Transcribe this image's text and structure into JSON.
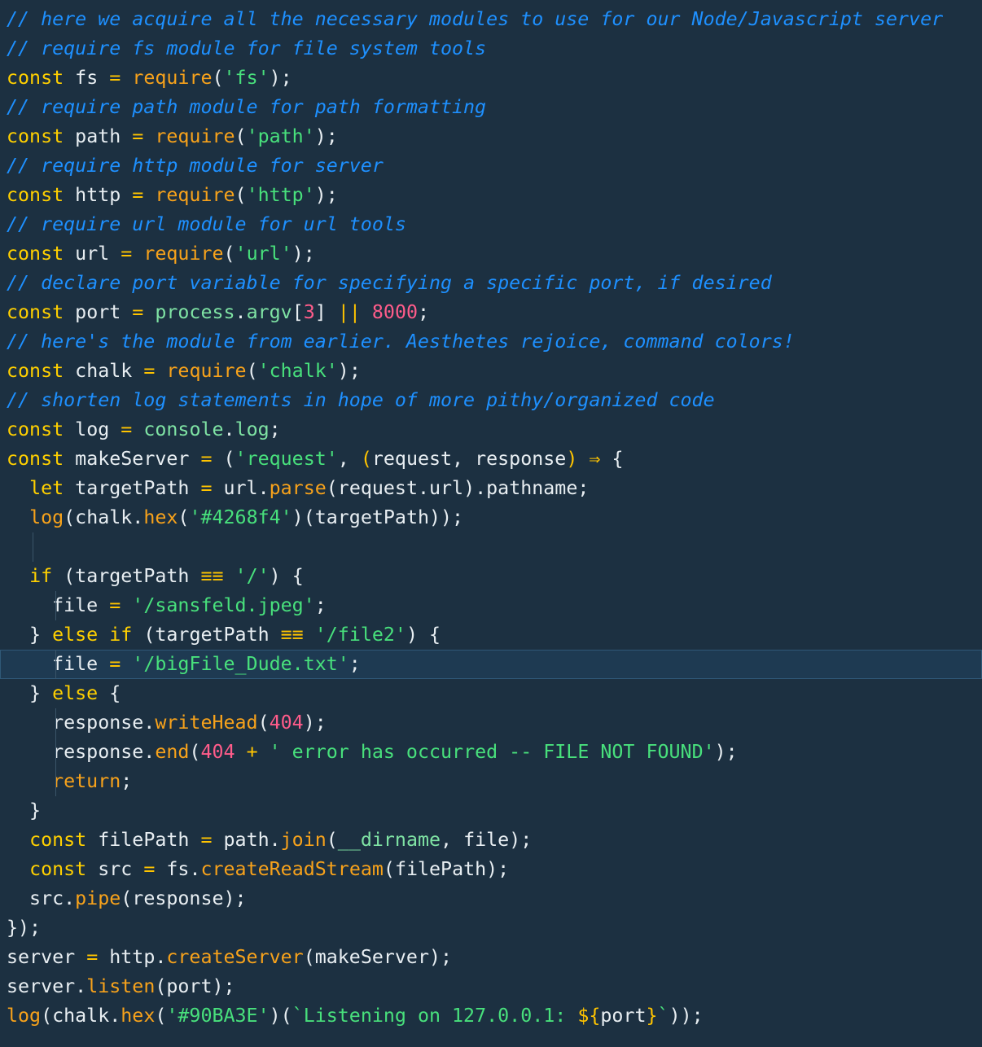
{
  "editor": {
    "colors": {
      "background": "#1c3041",
      "comment": "#1e90ff",
      "keyword": "#ffd000",
      "function": "#f7a21b",
      "string": "#48e07c",
      "number": "#ff5c8a",
      "operator": "#ffc400",
      "builtin": "#7fe3a4",
      "plain": "#e8eef2",
      "current_line": "#1e3a52"
    },
    "current_line_index": 22,
    "lines": [
      {
        "indent_guides": [],
        "tokens": [
          {
            "t": "comment",
            "v": "// here we acquire all the necessary modules to use for our Node/Javascript server"
          }
        ]
      },
      {
        "indent_guides": [],
        "tokens": [
          {
            "t": "comment",
            "v": "// require fs module for file system tools"
          }
        ]
      },
      {
        "indent_guides": [],
        "tokens": [
          {
            "t": "keyword",
            "v": "const"
          },
          {
            "t": "plain",
            "v": " fs "
          },
          {
            "t": "op",
            "v": "="
          },
          {
            "t": "plain",
            "v": " "
          },
          {
            "t": "func",
            "v": "require"
          },
          {
            "t": "punc",
            "v": "("
          },
          {
            "t": "string",
            "v": "'fs'"
          },
          {
            "t": "punc",
            "v": ");"
          }
        ]
      },
      {
        "indent_guides": [],
        "tokens": [
          {
            "t": "comment",
            "v": "// require path module for path formatting"
          }
        ]
      },
      {
        "indent_guides": [],
        "tokens": [
          {
            "t": "keyword",
            "v": "const"
          },
          {
            "t": "plain",
            "v": " path "
          },
          {
            "t": "op",
            "v": "="
          },
          {
            "t": "plain",
            "v": " "
          },
          {
            "t": "func",
            "v": "require"
          },
          {
            "t": "punc",
            "v": "("
          },
          {
            "t": "string",
            "v": "'path'"
          },
          {
            "t": "punc",
            "v": ");"
          }
        ]
      },
      {
        "indent_guides": [],
        "tokens": [
          {
            "t": "comment",
            "v": "// require http module for server"
          }
        ]
      },
      {
        "indent_guides": [],
        "tokens": [
          {
            "t": "keyword",
            "v": "const"
          },
          {
            "t": "plain",
            "v": " http "
          },
          {
            "t": "op",
            "v": "="
          },
          {
            "t": "plain",
            "v": " "
          },
          {
            "t": "func",
            "v": "require"
          },
          {
            "t": "punc",
            "v": "("
          },
          {
            "t": "string",
            "v": "'http'"
          },
          {
            "t": "punc",
            "v": ");"
          }
        ]
      },
      {
        "indent_guides": [],
        "tokens": [
          {
            "t": "comment",
            "v": "// require url module for url tools"
          }
        ]
      },
      {
        "indent_guides": [],
        "tokens": [
          {
            "t": "keyword",
            "v": "const"
          },
          {
            "t": "plain",
            "v": " url "
          },
          {
            "t": "op",
            "v": "="
          },
          {
            "t": "plain",
            "v": " "
          },
          {
            "t": "func",
            "v": "require"
          },
          {
            "t": "punc",
            "v": "("
          },
          {
            "t": "string",
            "v": "'url'"
          },
          {
            "t": "punc",
            "v": ");"
          }
        ]
      },
      {
        "indent_guides": [],
        "tokens": [
          {
            "t": "comment",
            "v": "// declare port variable for specifying a specific port, if desired"
          }
        ]
      },
      {
        "indent_guides": [],
        "tokens": [
          {
            "t": "keyword",
            "v": "const"
          },
          {
            "t": "plain",
            "v": " port "
          },
          {
            "t": "op",
            "v": "="
          },
          {
            "t": "plain",
            "v": " "
          },
          {
            "t": "builtin",
            "v": "process"
          },
          {
            "t": "punc",
            "v": "."
          },
          {
            "t": "builtin",
            "v": "argv"
          },
          {
            "t": "punc",
            "v": "["
          },
          {
            "t": "number",
            "v": "3"
          },
          {
            "t": "punc",
            "v": "] "
          },
          {
            "t": "op",
            "v": "||"
          },
          {
            "t": "plain",
            "v": " "
          },
          {
            "t": "number",
            "v": "8000"
          },
          {
            "t": "punc",
            "v": ";"
          }
        ]
      },
      {
        "indent_guides": [],
        "tokens": [
          {
            "t": "comment",
            "v": "// here's the module from earlier. Aesthetes rejoice, command colors!"
          }
        ]
      },
      {
        "indent_guides": [],
        "tokens": [
          {
            "t": "keyword",
            "v": "const"
          },
          {
            "t": "plain",
            "v": " chalk "
          },
          {
            "t": "op",
            "v": "="
          },
          {
            "t": "plain",
            "v": " "
          },
          {
            "t": "func",
            "v": "require"
          },
          {
            "t": "punc",
            "v": "("
          },
          {
            "t": "string",
            "v": "'chalk'"
          },
          {
            "t": "punc",
            "v": ");"
          }
        ]
      },
      {
        "indent_guides": [],
        "tokens": [
          {
            "t": "comment",
            "v": "// shorten log statements in hope of more pithy/organized code"
          }
        ]
      },
      {
        "indent_guides": [],
        "tokens": [
          {
            "t": "keyword",
            "v": "const"
          },
          {
            "t": "plain",
            "v": " log "
          },
          {
            "t": "op",
            "v": "="
          },
          {
            "t": "plain",
            "v": " "
          },
          {
            "t": "builtin",
            "v": "console"
          },
          {
            "t": "punc",
            "v": "."
          },
          {
            "t": "builtin",
            "v": "log"
          },
          {
            "t": "punc",
            "v": ";"
          }
        ]
      },
      {
        "indent_guides": [],
        "tokens": [
          {
            "t": "keyword",
            "v": "const"
          },
          {
            "t": "plain",
            "v": " makeServer "
          },
          {
            "t": "op",
            "v": "="
          },
          {
            "t": "plain",
            "v": " ("
          },
          {
            "t": "string",
            "v": "'request'"
          },
          {
            "t": "punc",
            "v": ", "
          },
          {
            "t": "op",
            "v": "("
          },
          {
            "t": "plain",
            "v": "request, response"
          },
          {
            "t": "op",
            "v": ")"
          },
          {
            "t": "plain",
            "v": " "
          },
          {
            "t": "op",
            "v": "⇒"
          },
          {
            "t": "plain",
            "v": " {"
          }
        ]
      },
      {
        "indent_guides": [],
        "tokens": [
          {
            "t": "plain",
            "v": "  "
          },
          {
            "t": "keyword",
            "v": "let"
          },
          {
            "t": "plain",
            "v": " targetPath "
          },
          {
            "t": "op",
            "v": "="
          },
          {
            "t": "plain",
            "v": " url."
          },
          {
            "t": "func",
            "v": "parse"
          },
          {
            "t": "punc",
            "v": "("
          },
          {
            "t": "plain",
            "v": "request.url"
          },
          {
            "t": "punc",
            "v": ")"
          },
          {
            "t": "plain",
            "v": ".pathname;"
          }
        ]
      },
      {
        "indent_guides": [],
        "tokens": [
          {
            "t": "plain",
            "v": "  "
          },
          {
            "t": "func",
            "v": "log"
          },
          {
            "t": "punc",
            "v": "("
          },
          {
            "t": "plain",
            "v": "chalk."
          },
          {
            "t": "func",
            "v": "hex"
          },
          {
            "t": "punc",
            "v": "("
          },
          {
            "t": "string",
            "v": "'#4268f4'"
          },
          {
            "t": "punc",
            "v": ")("
          },
          {
            "t": "plain",
            "v": "targetPath"
          },
          {
            "t": "punc",
            "v": "));"
          }
        ]
      },
      {
        "indent_guides": [
          2
        ],
        "tokens": []
      },
      {
        "indent_guides": [],
        "tokens": [
          {
            "t": "plain",
            "v": "  "
          },
          {
            "t": "keyword",
            "v": "if"
          },
          {
            "t": "plain",
            "v": " (targetPath "
          },
          {
            "t": "op",
            "v": "≡≡"
          },
          {
            "t": "plain",
            "v": " "
          },
          {
            "t": "string",
            "v": "'/'"
          },
          {
            "t": "punc",
            "v": ") {"
          }
        ]
      },
      {
        "indent_guides": [
          4
        ],
        "tokens": [
          {
            "t": "plain",
            "v": "    file "
          },
          {
            "t": "op",
            "v": "="
          },
          {
            "t": "plain",
            "v": " "
          },
          {
            "t": "string",
            "v": "'/sansfeld.jpeg'"
          },
          {
            "t": "punc",
            "v": ";"
          }
        ]
      },
      {
        "indent_guides": [],
        "tokens": [
          {
            "t": "plain",
            "v": "  } "
          },
          {
            "t": "keyword",
            "v": "else"
          },
          {
            "t": "plain",
            "v": " "
          },
          {
            "t": "keyword",
            "v": "if"
          },
          {
            "t": "plain",
            "v": " (targetPath "
          },
          {
            "t": "op",
            "v": "≡≡"
          },
          {
            "t": "plain",
            "v": " "
          },
          {
            "t": "string",
            "v": "'/file2'"
          },
          {
            "t": "punc",
            "v": ") {"
          }
        ]
      },
      {
        "indent_guides": [
          4
        ],
        "tokens": [
          {
            "t": "plain",
            "v": "    file "
          },
          {
            "t": "op",
            "v": "="
          },
          {
            "t": "plain",
            "v": " "
          },
          {
            "t": "string",
            "v": "'/bigFile_Dude.txt'"
          },
          {
            "t": "punc",
            "v": ";"
          }
        ]
      },
      {
        "indent_guides": [],
        "tokens": [
          {
            "t": "plain",
            "v": "  } "
          },
          {
            "t": "keyword",
            "v": "else"
          },
          {
            "t": "plain",
            "v": " {"
          }
        ]
      },
      {
        "indent_guides": [
          4
        ],
        "tokens": [
          {
            "t": "plain",
            "v": "    response."
          },
          {
            "t": "func",
            "v": "writeHead"
          },
          {
            "t": "punc",
            "v": "("
          },
          {
            "t": "number",
            "v": "404"
          },
          {
            "t": "punc",
            "v": ");"
          }
        ]
      },
      {
        "indent_guides": [
          4
        ],
        "tokens": [
          {
            "t": "plain",
            "v": "    response."
          },
          {
            "t": "func",
            "v": "end"
          },
          {
            "t": "punc",
            "v": "("
          },
          {
            "t": "number",
            "v": "404"
          },
          {
            "t": "plain",
            "v": " "
          },
          {
            "t": "op",
            "v": "+"
          },
          {
            "t": "plain",
            "v": " "
          },
          {
            "t": "string",
            "v": "' error has occurred -- FILE NOT FOUND'"
          },
          {
            "t": "punc",
            "v": ");"
          }
        ]
      },
      {
        "indent_guides": [
          4
        ],
        "tokens": [
          {
            "t": "plain",
            "v": "    "
          },
          {
            "t": "func",
            "v": "return"
          },
          {
            "t": "punc",
            "v": ";"
          }
        ]
      },
      {
        "indent_guides": [],
        "tokens": [
          {
            "t": "plain",
            "v": "  }"
          }
        ]
      },
      {
        "indent_guides": [],
        "tokens": [
          {
            "t": "plain",
            "v": "  "
          },
          {
            "t": "keyword",
            "v": "const"
          },
          {
            "t": "plain",
            "v": " filePath "
          },
          {
            "t": "op",
            "v": "="
          },
          {
            "t": "plain",
            "v": " path."
          },
          {
            "t": "func",
            "v": "join"
          },
          {
            "t": "punc",
            "v": "("
          },
          {
            "t": "builtin",
            "v": "__dirname"
          },
          {
            "t": "punc",
            "v": ", "
          },
          {
            "t": "plain",
            "v": "file"
          },
          {
            "t": "punc",
            "v": ");"
          }
        ]
      },
      {
        "indent_guides": [],
        "tokens": [
          {
            "t": "plain",
            "v": "  "
          },
          {
            "t": "keyword",
            "v": "const"
          },
          {
            "t": "plain",
            "v": " src "
          },
          {
            "t": "op",
            "v": "="
          },
          {
            "t": "plain",
            "v": " fs."
          },
          {
            "t": "func",
            "v": "createReadStream"
          },
          {
            "t": "punc",
            "v": "("
          },
          {
            "t": "plain",
            "v": "filePath"
          },
          {
            "t": "punc",
            "v": ");"
          }
        ]
      },
      {
        "indent_guides": [],
        "tokens": [
          {
            "t": "plain",
            "v": "  src."
          },
          {
            "t": "func",
            "v": "pipe"
          },
          {
            "t": "punc",
            "v": "("
          },
          {
            "t": "plain",
            "v": "response"
          },
          {
            "t": "punc",
            "v": ");"
          }
        ]
      },
      {
        "indent_guides": [],
        "tokens": [
          {
            "t": "punc",
            "v": "});"
          }
        ]
      },
      {
        "indent_guides": [],
        "tokens": [
          {
            "t": "plain",
            "v": "server "
          },
          {
            "t": "op",
            "v": "="
          },
          {
            "t": "plain",
            "v": " http."
          },
          {
            "t": "func",
            "v": "createServer"
          },
          {
            "t": "punc",
            "v": "("
          },
          {
            "t": "plain",
            "v": "makeServer"
          },
          {
            "t": "punc",
            "v": ");"
          }
        ]
      },
      {
        "indent_guides": [],
        "tokens": [
          {
            "t": "plain",
            "v": "server."
          },
          {
            "t": "func",
            "v": "listen"
          },
          {
            "t": "punc",
            "v": "("
          },
          {
            "t": "plain",
            "v": "port"
          },
          {
            "t": "punc",
            "v": ");"
          }
        ]
      },
      {
        "indent_guides": [],
        "tokens": [
          {
            "t": "func",
            "v": "log"
          },
          {
            "t": "punc",
            "v": "("
          },
          {
            "t": "plain",
            "v": "chalk."
          },
          {
            "t": "func",
            "v": "hex"
          },
          {
            "t": "punc",
            "v": "("
          },
          {
            "t": "string",
            "v": "'#90BA3E'"
          },
          {
            "t": "punc",
            "v": ")("
          },
          {
            "t": "string",
            "v": "`Listening on 127.0.0.1: "
          },
          {
            "t": "op",
            "v": "${"
          },
          {
            "t": "plain",
            "v": "port"
          },
          {
            "t": "op",
            "v": "}"
          },
          {
            "t": "string",
            "v": "`"
          },
          {
            "t": "punc",
            "v": "));"
          }
        ]
      }
    ]
  }
}
